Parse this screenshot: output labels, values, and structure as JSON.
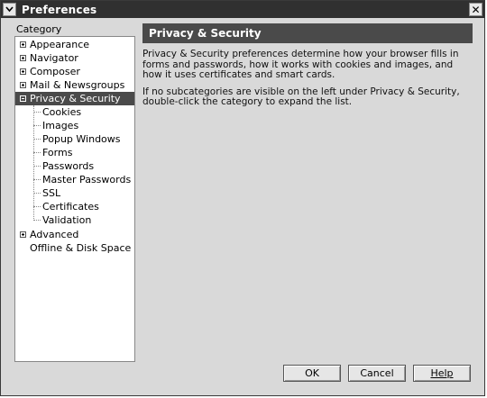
{
  "window": {
    "title": "Preferences"
  },
  "sidebar": {
    "category_label": "Category",
    "items": [
      {
        "label": "Appearance",
        "expander": "plus"
      },
      {
        "label": "Navigator",
        "expander": "plus"
      },
      {
        "label": "Composer",
        "expander": "plus"
      },
      {
        "label": "Mail & Newsgroups",
        "expander": "plus"
      },
      {
        "label": "Privacy & Security",
        "expander": "minus",
        "selected": true
      },
      {
        "label": "Cookies"
      },
      {
        "label": "Images"
      },
      {
        "label": "Popup Windows"
      },
      {
        "label": "Forms"
      },
      {
        "label": "Passwords"
      },
      {
        "label": "Master Passwords"
      },
      {
        "label": "SSL"
      },
      {
        "label": "Certificates"
      },
      {
        "label": "Validation"
      },
      {
        "label": "Advanced",
        "expander": "plus"
      },
      {
        "label": "Offline & Disk Space"
      }
    ]
  },
  "main": {
    "header": "Privacy & Security",
    "paragraph1": "Privacy & Security preferences determine how your browser fills in forms and passwords, how it works with cookies and images, and how it uses certificates and smart cards.",
    "paragraph2": "If no subcategories are visible on the left under Privacy & Security, double-click the category to expand the list."
  },
  "buttons": {
    "ok": "OK",
    "cancel": "Cancel",
    "help": "Help"
  },
  "colors": {
    "titlebar": "#303030",
    "selection": "#4a4a4a",
    "dialog_bg": "#d9d9d9"
  }
}
